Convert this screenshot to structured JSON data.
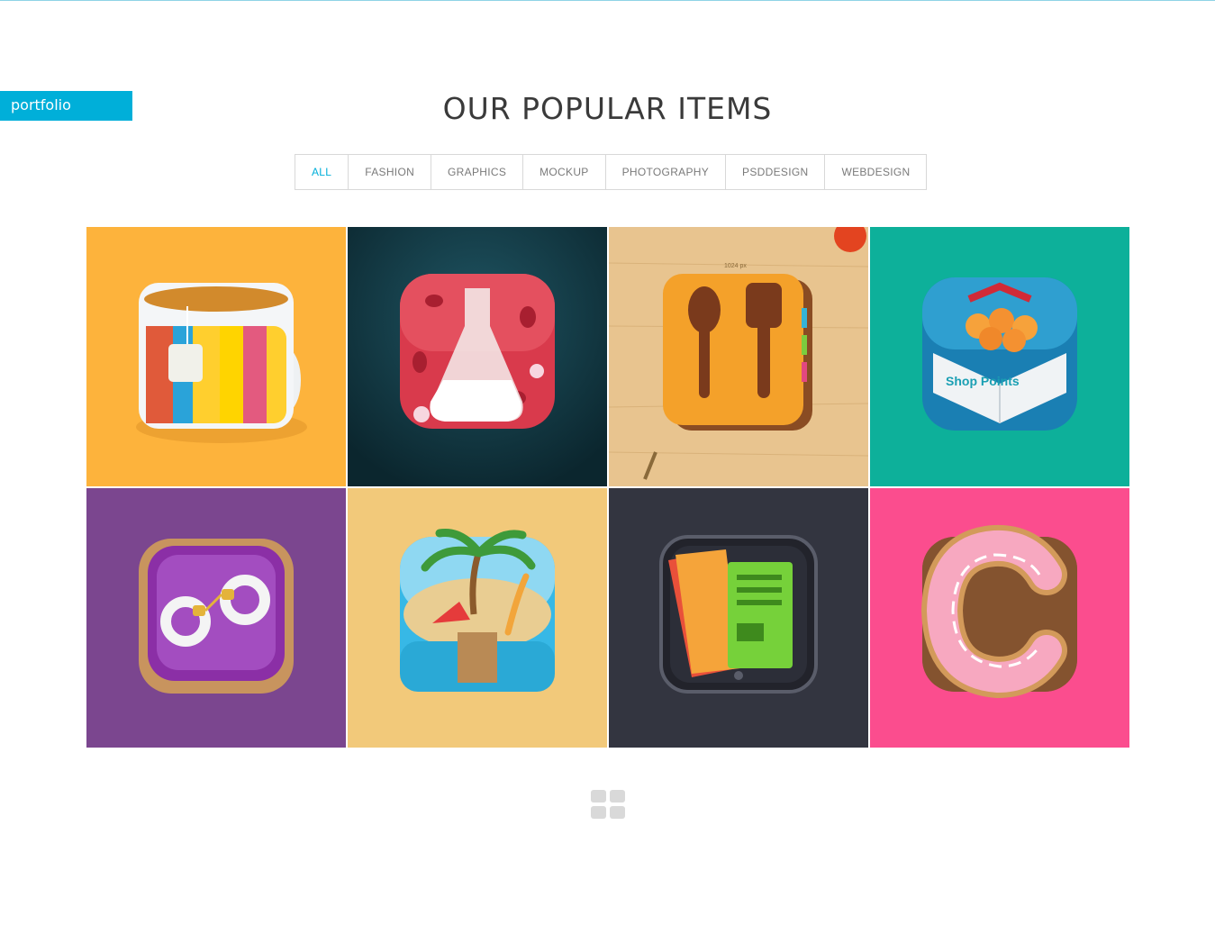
{
  "section_tag": "portfolio",
  "title": "OUR POPULAR ITEMS",
  "filters": [
    "ALL",
    "FASHION",
    "GRAPHICS",
    "MOCKUP",
    "PHOTOGRAPHY",
    "PSDDESIGN",
    "WEBDESIGN"
  ],
  "active_filter": "ALL",
  "accent_color": "#00afd9",
  "items": [
    {
      "icon": "tea-mug-icon",
      "bg": "#fdb33c"
    },
    {
      "icon": "lab-flask-icon",
      "bg": "#0e2f38"
    },
    {
      "icon": "recipe-book-icon",
      "bg": "#e8c48f",
      "text": "1024 px"
    },
    {
      "icon": "shop-points-gift-box-icon",
      "bg": "#0db09a",
      "text": "Shop Points"
    },
    {
      "icon": "pillow-handcuffs-icon",
      "bg": "#7b468f"
    },
    {
      "icon": "beach-island-icon",
      "bg": "#f2c97a"
    },
    {
      "icon": "newsstand-icon",
      "bg": "#333540"
    },
    {
      "icon": "donut-c-icon",
      "bg": "#fb4d8e"
    }
  ]
}
